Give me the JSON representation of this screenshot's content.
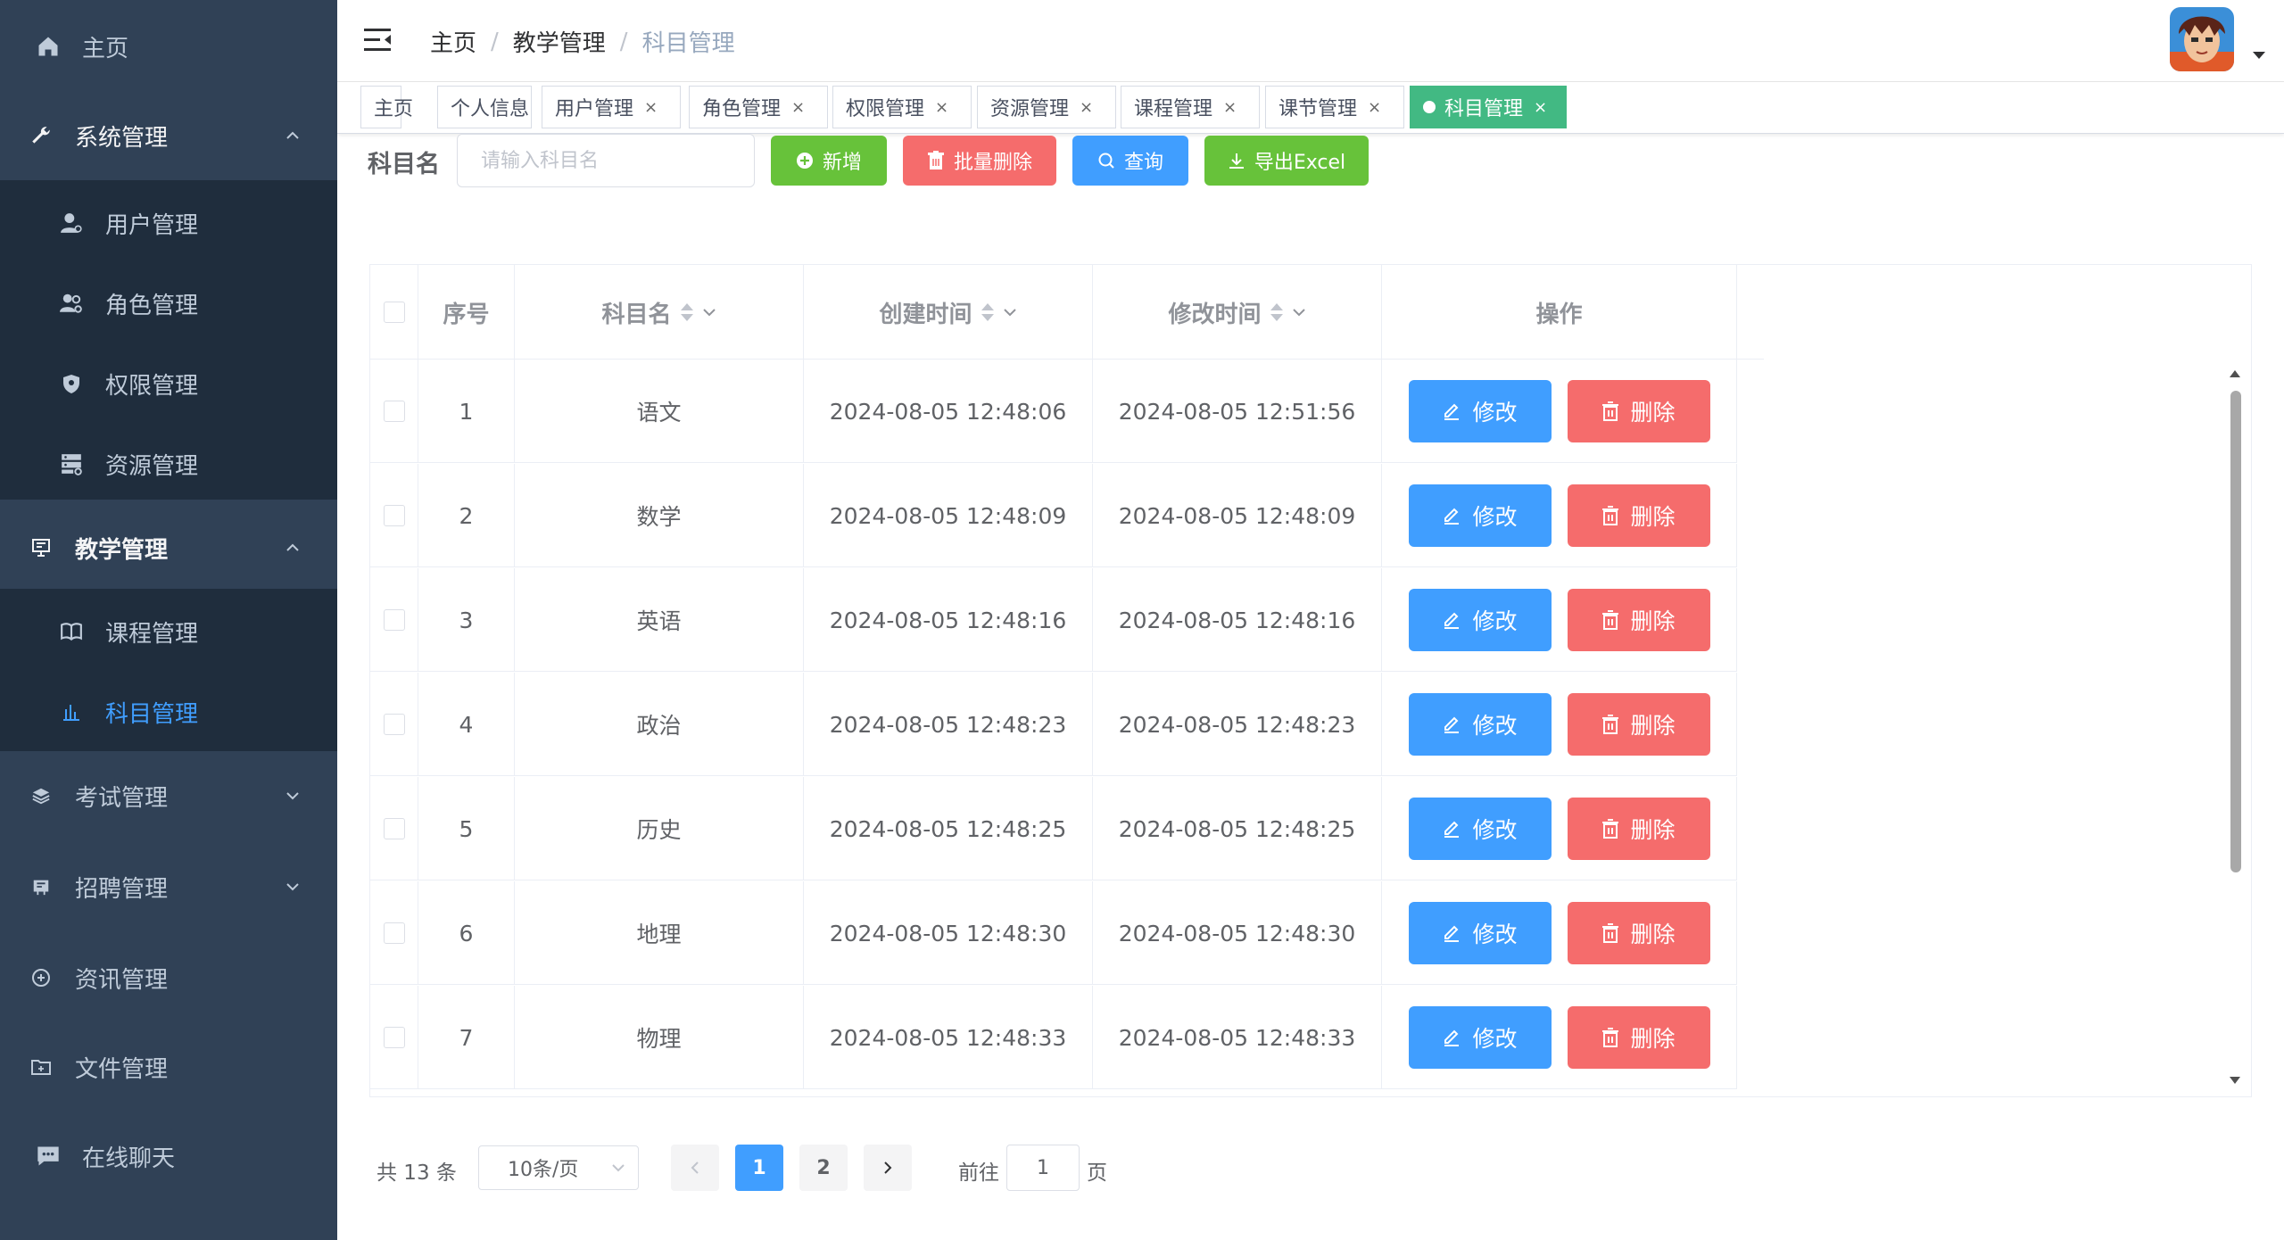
{
  "colors": {
    "sidebar_bg": "#304156",
    "submenu_bg": "#1f2d3d",
    "accent": "#409eff",
    "success": "#67c23a",
    "danger": "#f56c6c",
    "tag_active": "#42b983"
  },
  "sidebar": {
    "home": {
      "label": "主页",
      "icon": "home-icon"
    },
    "system": {
      "label": "系统管理",
      "icon": "wrench-icon",
      "expanded": true,
      "children": [
        {
          "label": "用户管理",
          "icon": "user-icon"
        },
        {
          "label": "角色管理",
          "icon": "users-icon"
        },
        {
          "label": "权限管理",
          "icon": "shield-icon"
        },
        {
          "label": "资源管理",
          "icon": "server-icon"
        }
      ]
    },
    "teaching": {
      "label": "教学管理",
      "icon": "board-icon",
      "expanded": true,
      "children": [
        {
          "label": "课程管理",
          "icon": "book-icon"
        },
        {
          "label": "科目管理",
          "icon": "bar-chart-icon",
          "active": true
        }
      ]
    },
    "exam": {
      "label": "考试管理",
      "icon": "layers-icon"
    },
    "recruit": {
      "label": "招聘管理",
      "icon": "recruit-icon"
    },
    "news": {
      "label": "资讯管理",
      "icon": "news-icon"
    },
    "files": {
      "label": "文件管理",
      "icon": "folder-icon"
    },
    "chat": {
      "label": "在线聊天",
      "icon": "chat-icon"
    }
  },
  "breadcrumb": [
    "主页",
    "教学管理",
    "科目管理"
  ],
  "tags": [
    {
      "label": "主页",
      "closable": false
    },
    {
      "label": "个人信息",
      "closable": false
    },
    {
      "label": "用户管理",
      "closable": true
    },
    {
      "label": "角色管理",
      "closable": true
    },
    {
      "label": "权限管理",
      "closable": true
    },
    {
      "label": "资源管理",
      "closable": true
    },
    {
      "label": "课程管理",
      "closable": true
    },
    {
      "label": "课节管理",
      "closable": true
    },
    {
      "label": "科目管理",
      "closable": true,
      "active": true
    }
  ],
  "tag_close": "×",
  "toolbar": {
    "label": "科目名",
    "placeholder": "请输入科目名",
    "add": "新增",
    "batch_delete": "批量删除",
    "query": "查询",
    "export": "导出Excel"
  },
  "table": {
    "headers": {
      "index": "序号",
      "name": "科目名",
      "created": "创建时间",
      "modified": "修改时间",
      "actions": "操作"
    },
    "edit_label": "修改",
    "delete_label": "删除",
    "rows": [
      {
        "index": "1",
        "name": "语文",
        "created": "2024-08-05 12:48:06",
        "modified": "2024-08-05 12:51:56"
      },
      {
        "index": "2",
        "name": "数学",
        "created": "2024-08-05 12:48:09",
        "modified": "2024-08-05 12:48:09"
      },
      {
        "index": "3",
        "name": "英语",
        "created": "2024-08-05 12:48:16",
        "modified": "2024-08-05 12:48:16"
      },
      {
        "index": "4",
        "name": "政治",
        "created": "2024-08-05 12:48:23",
        "modified": "2024-08-05 12:48:23"
      },
      {
        "index": "5",
        "name": "历史",
        "created": "2024-08-05 12:48:25",
        "modified": "2024-08-05 12:48:25"
      },
      {
        "index": "6",
        "name": "地理",
        "created": "2024-08-05 12:48:30",
        "modified": "2024-08-05 12:48:30"
      },
      {
        "index": "7",
        "name": "物理",
        "created": "2024-08-05 12:48:33",
        "modified": "2024-08-05 12:48:33"
      }
    ]
  },
  "pagination": {
    "total": "共 13 条",
    "page_size": "10条/页",
    "pages": [
      "1",
      "2"
    ],
    "current": "1",
    "goto_prefix": "前往",
    "goto_value": "1",
    "goto_suffix": "页"
  }
}
